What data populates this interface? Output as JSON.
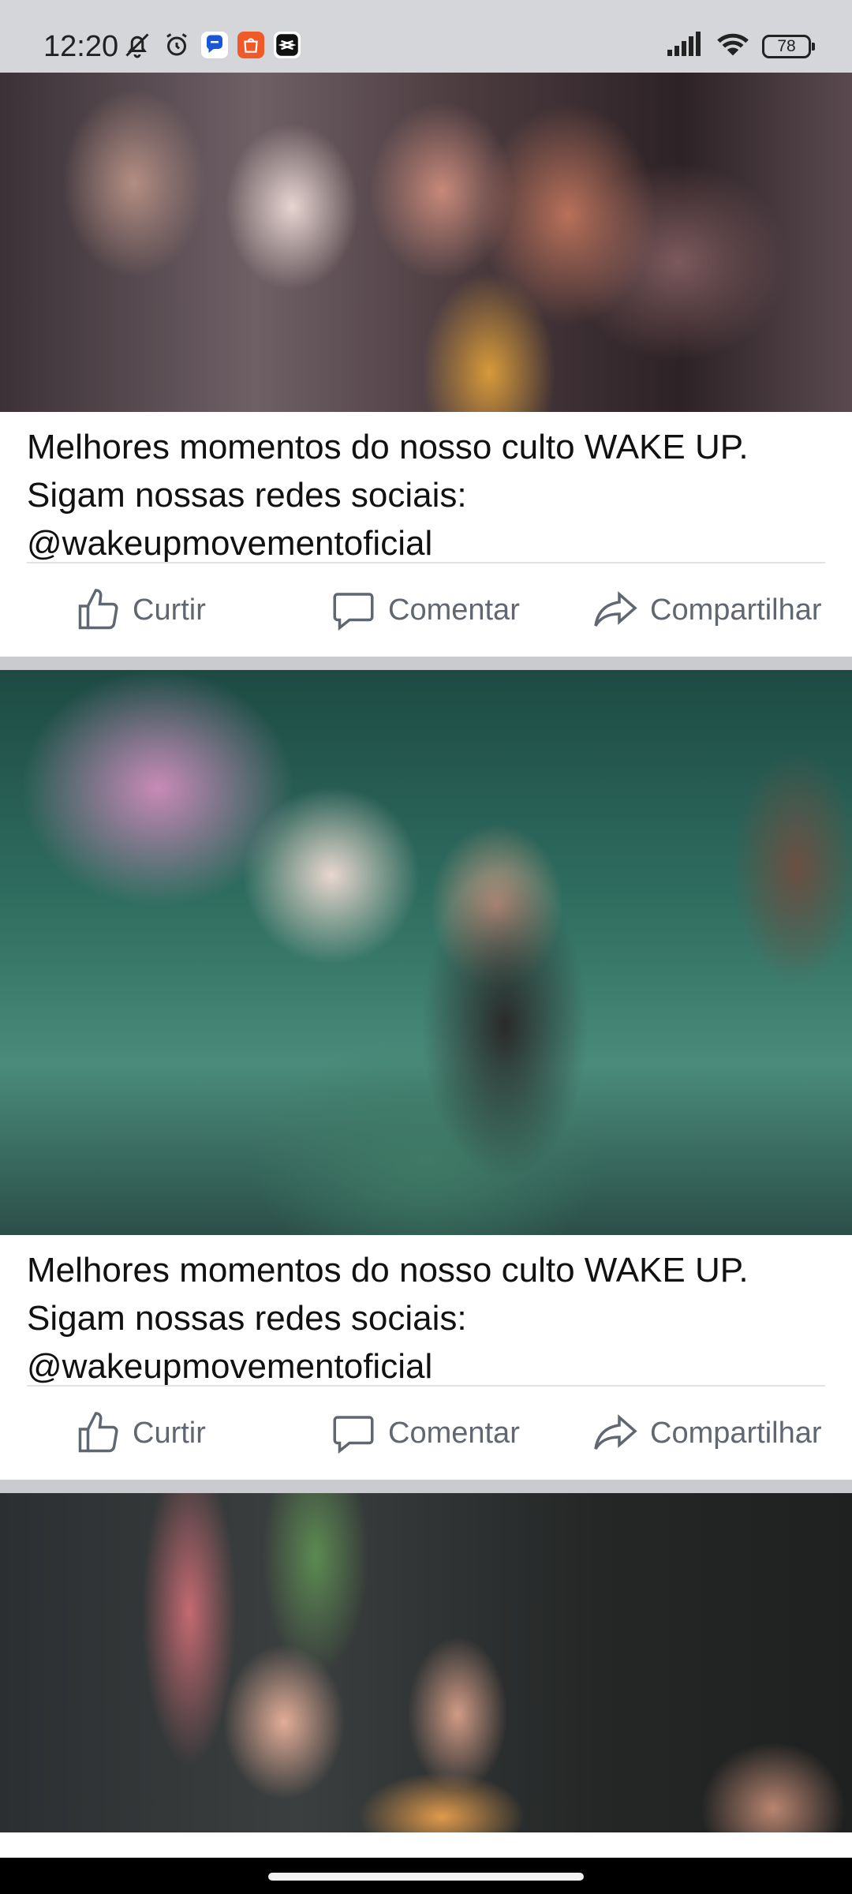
{
  "status_bar": {
    "time": "12:20",
    "battery": "78",
    "left_icons": [
      "bell-off-icon",
      "alarm-icon",
      "chat-app-icon",
      "shopee-app-icon",
      "capcut-app-icon"
    ],
    "right_icons": [
      "signal-icon",
      "wifi-icon",
      "battery-icon"
    ]
  },
  "posts": [
    {
      "caption_lines": [
        "Melhores momentos do nosso culto WAKE UP.",
        "Sigam nossas redes sociais:",
        "@wakeupmovementoficial"
      ],
      "actions": {
        "like": "Curtir",
        "comment": "Comentar",
        "share": "Compartilhar"
      }
    },
    {
      "caption_lines": [
        "Melhores momentos do nosso culto WAKE UP.",
        "Sigam nossas redes sociais:",
        "@wakeupmovementoficial"
      ],
      "actions": {
        "like": "Curtir",
        "comment": "Comentar",
        "share": "Compartilhar"
      }
    }
  ],
  "colors": {
    "status_bar_bg": "#d4d6d9",
    "action_text": "#606770",
    "separator": "#c9cbce"
  }
}
